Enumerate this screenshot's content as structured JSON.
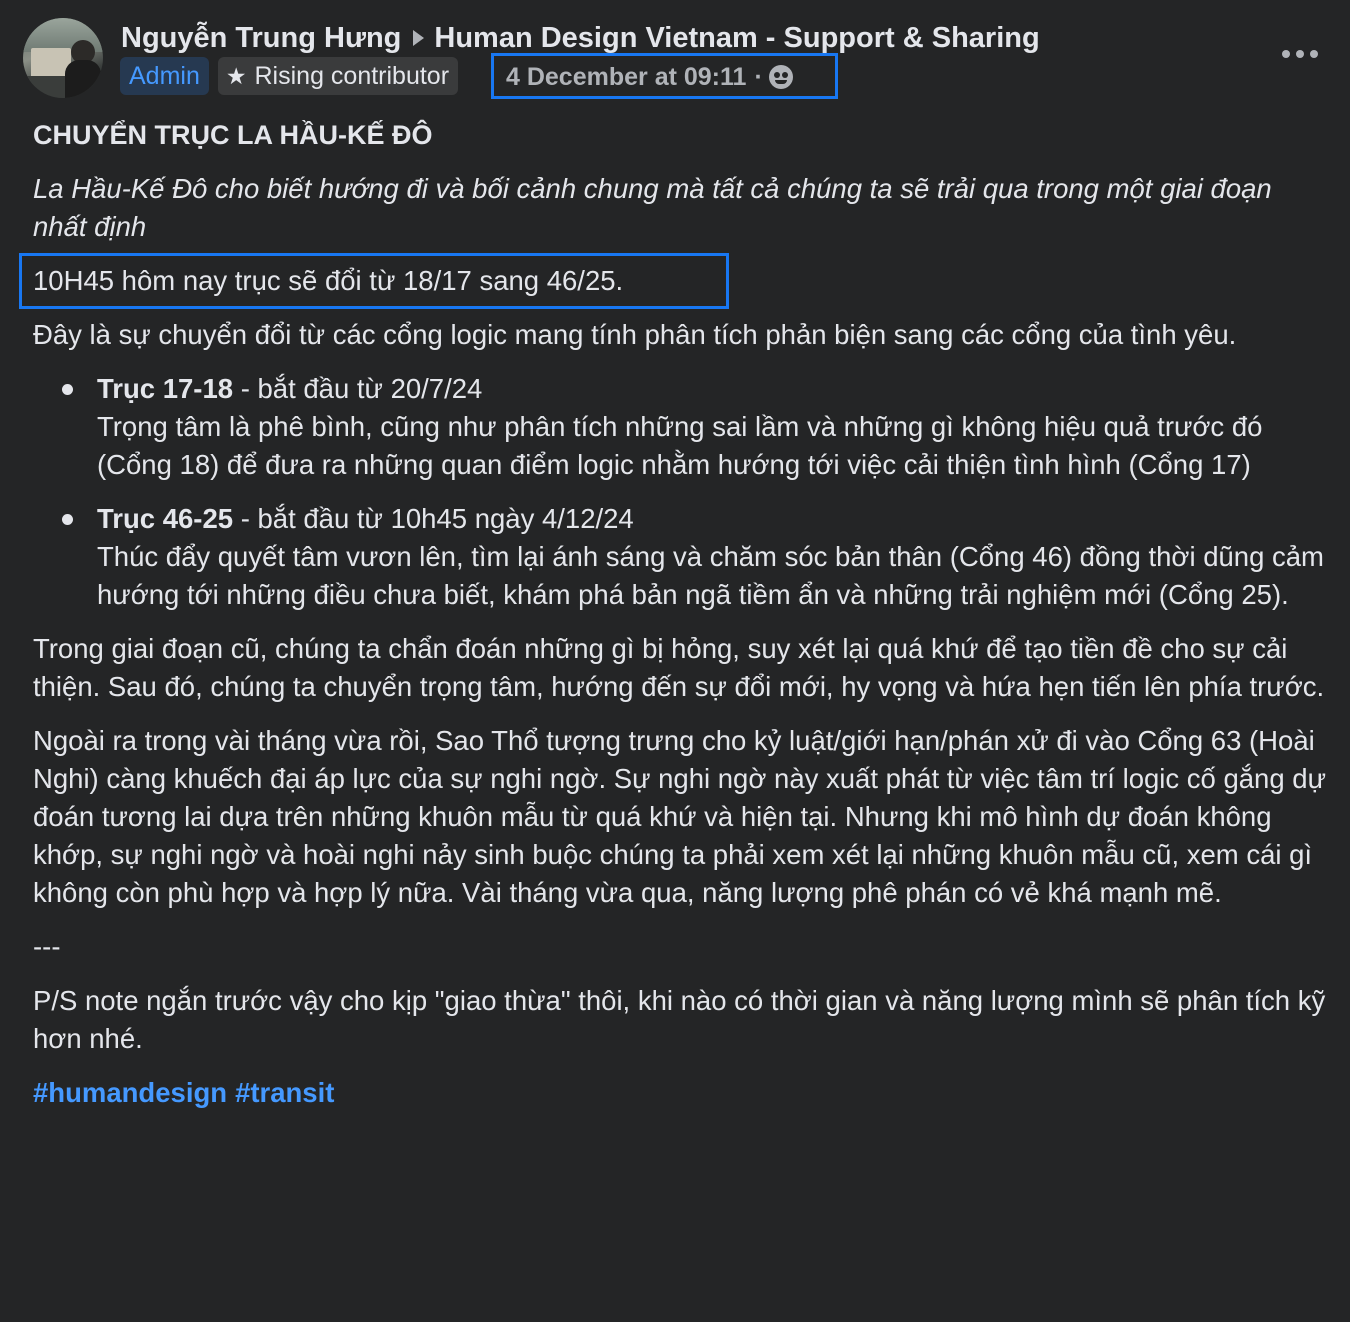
{
  "header": {
    "author": "Nguyễn Trung Hưng",
    "group": "Human Design Vietnam - Support & Sharing",
    "admin_badge": "Admin",
    "rising_badge": "Rising contributor",
    "date": "4 December at 09:11",
    "date_separator": "·",
    "audience_icon": "group-audience-icon",
    "more_icon": "more-options-icon"
  },
  "post": {
    "title": "CHUYỂN TRỤC LA HẦU-KẾ ĐÔ",
    "intro": "La Hầu-Kế Đô cho biết hướng đi và bối cảnh chung mà tất cả chúng ta sẽ trải qua trong một giai đoạn nhất định",
    "shift": "10H45 hôm nay trục sẽ đổi từ 18/17 sang 46/25.",
    "summary": "Đây là sự chuyển đổi từ các cổng logic mang tính phân tích phản biện sang các cổng của tình yêu.",
    "axes": [
      {
        "name": "Trục 17-18",
        "start": " - bắt đầu từ 20/7/24",
        "desc": "Trọng tâm là phê bình, cũng như phân tích những sai lầm và những gì không hiệu quả trước đó (Cổng 18) để đưa ra những quan điểm logic nhằm hướng tới việc cải thiện tình hình (Cổng 17)"
      },
      {
        "name": "Trục 46-25",
        "start": " - bắt đầu từ 10h45 ngày 4/12/24",
        "desc": "Thúc đẩy quyết tâm vươn lên, tìm lại ánh sáng và chăm sóc bản thân (Cổng 46) đồng thời dũng cảm hướng tới những điều chưa biết, khám phá bản ngã tiềm ẩn và những trải nghiệm mới (Cổng 25)."
      }
    ],
    "para_old_phase": "Trong giai đoạn cũ, chúng ta chẩn đoán những gì bị hỏng, suy xét lại quá khứ để tạo tiền đề cho sự cải thiện. Sau đó, chúng ta chuyển trọng tâm, hướng đến sự đổi mới, hy vọng và hứa hẹn tiến lên phía trước.",
    "para_saturn": "Ngoài ra trong vài tháng vừa rồi, Sao Thổ tượng trưng cho kỷ luật/giới hạn/phán xử đi vào Cổng 63 (Hoài Nghi) càng khuếch đại áp lực của sự nghi ngờ. Sự nghi ngờ này xuất phát từ việc tâm trí logic cố gắng dự đoán tương lai dựa trên những khuôn mẫu từ quá khứ và hiện tại. Nhưng khi mô hình dự đoán không khớp, sự nghi ngờ và hoài nghi nảy sinh buộc chúng ta phải xem xét lại những khuôn mẫu cũ, xem cái gì không còn phù hợp và hợp lý nữa. Vài tháng vừa qua, năng lượng phê phán có vẻ khá mạnh mẽ.",
    "divider": "---",
    "ps": "P/S note ngắn trước vậy cho kịp \"giao thừa\" thôi, khi nào có thời gian và năng lượng mình sẽ phân tích kỹ hơn nhé.",
    "hashtags": [
      "#humandesign",
      "#transit"
    ]
  },
  "colors": {
    "background": "#242526",
    "text": "#e4e6eb",
    "secondary": "#b0b3b8",
    "link": "#4599ff",
    "highlight_box": "#1877f2"
  }
}
